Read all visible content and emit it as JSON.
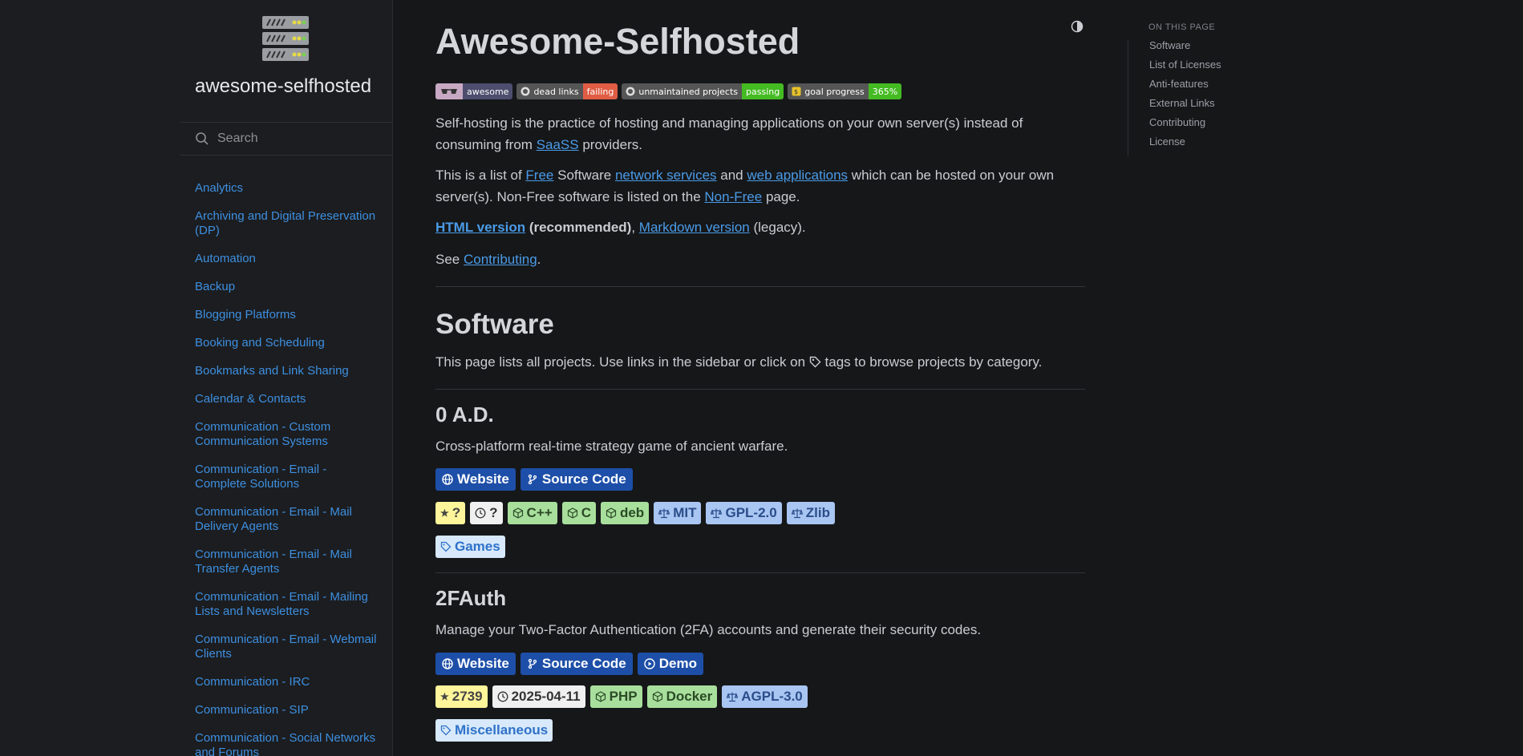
{
  "sidebar": {
    "site_title": "awesome-selfhosted",
    "search_placeholder": "Search",
    "nav": [
      "Analytics",
      "Archiving and Digital Preservation (DP)",
      "Automation",
      "Backup",
      "Blogging Platforms",
      "Booking and Scheduling",
      "Bookmarks and Link Sharing",
      "Calendar & Contacts",
      "Communication - Custom Communication Systems",
      "Communication - Email - Complete Solutions",
      "Communication - Email - Mail Delivery Agents",
      "Communication - Email - Mail Transfer Agents",
      "Communication - Email - Mailing Lists and Newsletters",
      "Communication - Email - Webmail Clients",
      "Communication - IRC",
      "Communication - SIP",
      "Communication - Social Networks and Forums"
    ]
  },
  "main": {
    "title": "Awesome-Selfhosted",
    "badges": [
      {
        "left": "awesome",
        "right": "",
        "color": "#4a4a6a"
      },
      {
        "left": "dead links",
        "right": "failing",
        "color": "#e05d44"
      },
      {
        "left": "unmaintained projects",
        "right": "passing",
        "color": "#4c1"
      },
      {
        "left": "goal progress",
        "right": "365%",
        "color": "#4c1"
      }
    ],
    "intro1_a": "Self-hosting is the practice of hosting and managing applications on your own server(s) instead of consuming from ",
    "intro1_link": "SaaSS",
    "intro1_b": " providers.",
    "intro2_a": "This is a list of ",
    "intro2_free": "Free",
    "intro2_b": " Software ",
    "intro2_net": "network services",
    "intro2_c": " and ",
    "intro2_web": "web applications",
    "intro2_d": " which can be hosted on your own server(s). Non-Free software is listed on the ",
    "intro2_nonfree": "Non-Free",
    "intro2_e": " page.",
    "html_version": "HTML version",
    "recommended": " (recommended)",
    "comma": ", ",
    "markdown_version": "Markdown version",
    "legacy": " (legacy).",
    "see": "See ",
    "contributing": "Contributing",
    "period": ".",
    "software_heading": "Software",
    "software_desc_a": "This page lists all projects. Use links in the sidebar or click on ",
    "software_desc_b": " tags to browse projects by category.",
    "projects": [
      {
        "name": "0 A.D.",
        "desc": "Cross-platform real-time strategy game of ancient warfare.",
        "links": [
          "Website",
          "Source Code"
        ],
        "stars": "?",
        "date": "?",
        "langs": [
          "C++",
          "C",
          "deb"
        ],
        "licenses": [
          "MIT",
          "GPL-2.0",
          "Zlib"
        ],
        "category": "Games"
      },
      {
        "name": "2FAuth",
        "desc": "Manage your Two-Factor Authentication (2FA) accounts and generate their security codes.",
        "links": [
          "Website",
          "Source Code",
          "Demo"
        ],
        "stars": "2739",
        "date": "2025-04-11",
        "langs": [
          "PHP",
          "Docker"
        ],
        "licenses": [
          "AGPL-3.0"
        ],
        "category": "Miscellaneous"
      }
    ]
  },
  "toc": {
    "title": "ON THIS PAGE",
    "items": [
      "Software",
      "List of Licenses",
      "Anti-features",
      "External Links",
      "Contributing",
      "License"
    ]
  }
}
